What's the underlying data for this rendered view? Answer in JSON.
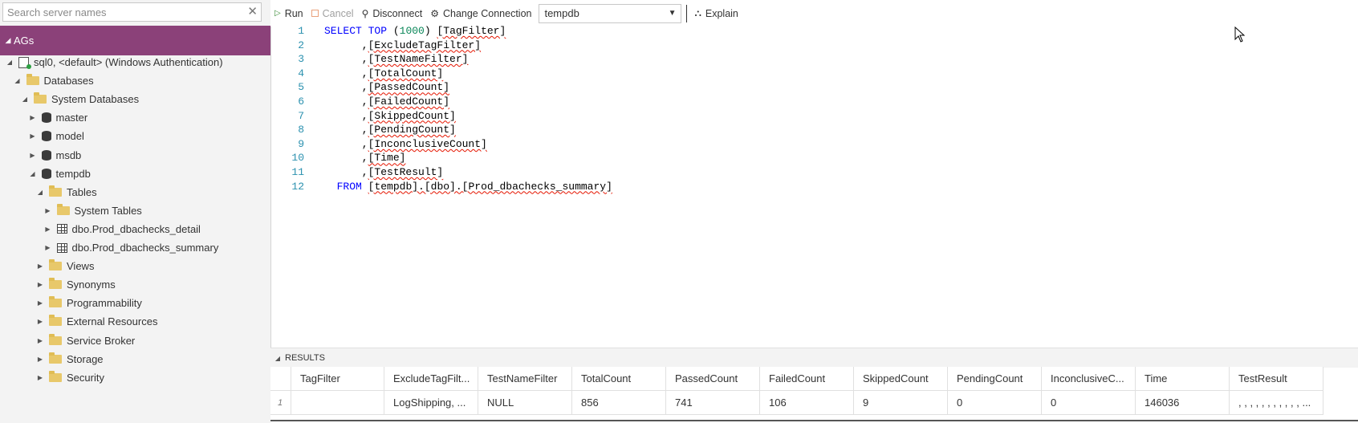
{
  "sidebar": {
    "search_placeholder": "Search server names",
    "group_label": "AGs",
    "tree": [
      {
        "label": "sql0, <default> (Windows Authentication)",
        "icon": "server-icon",
        "level": 1,
        "expanded": true
      },
      {
        "label": "Databases",
        "icon": "folder-icon",
        "level": 2,
        "expanded": true
      },
      {
        "label": "System Databases",
        "icon": "folder-icon",
        "level": 3,
        "expanded": true
      },
      {
        "label": "master",
        "icon": "database-icon",
        "level": 4,
        "expanded": false
      },
      {
        "label": "model",
        "icon": "database-icon",
        "level": 4,
        "expanded": false
      },
      {
        "label": "msdb",
        "icon": "database-icon",
        "level": 4,
        "expanded": false
      },
      {
        "label": "tempdb",
        "icon": "database-icon",
        "level": 4,
        "expanded": true
      },
      {
        "label": "Tables",
        "icon": "folder-icon",
        "level": 5,
        "expanded": true
      },
      {
        "label": "System Tables",
        "icon": "folder-icon",
        "level": 6,
        "expanded": false
      },
      {
        "label": "dbo.Prod_dbachecks_detail",
        "icon": "table-icon",
        "level": 6,
        "expanded": false
      },
      {
        "label": "dbo.Prod_dbachecks_summary",
        "icon": "table-icon",
        "level": 6,
        "expanded": false
      },
      {
        "label": "Views",
        "icon": "folder-icon",
        "level": 5,
        "expanded": false
      },
      {
        "label": "Synonyms",
        "icon": "folder-icon",
        "level": 5,
        "expanded": false
      },
      {
        "label": "Programmability",
        "icon": "folder-icon",
        "level": 5,
        "expanded": false
      },
      {
        "label": "External Resources",
        "icon": "folder-icon",
        "level": 5,
        "expanded": false
      },
      {
        "label": "Service Broker",
        "icon": "folder-icon",
        "level": 5,
        "expanded": false
      },
      {
        "label": "Storage",
        "icon": "folder-icon",
        "level": 5,
        "expanded": false
      },
      {
        "label": "Security",
        "icon": "folder-icon",
        "level": 5,
        "expanded": false
      }
    ]
  },
  "toolbar": {
    "run_label": "Run",
    "cancel_label": "Cancel",
    "disconnect_label": "Disconnect",
    "change_connection_label": "Change Connection",
    "database": "tempdb",
    "explain_label": "Explain"
  },
  "editor": {
    "lines": [
      {
        "num": "1",
        "tokens": [
          {
            "t": "SELECT",
            "c": "kw"
          },
          {
            "t": " "
          },
          {
            "t": "TOP",
            "c": "kw"
          },
          {
            "t": " ("
          },
          {
            "t": "1000",
            "c": "num"
          },
          {
            "t": ") "
          },
          {
            "t": "[TagFilter]",
            "c": "sq"
          }
        ]
      },
      {
        "num": "2",
        "tokens": [
          {
            "t": "      ,"
          },
          {
            "t": "[ExcludeTagFilter]",
            "c": "sq"
          }
        ]
      },
      {
        "num": "3",
        "tokens": [
          {
            "t": "      ,"
          },
          {
            "t": "[TestNameFilter]",
            "c": "sq"
          }
        ]
      },
      {
        "num": "4",
        "tokens": [
          {
            "t": "      ,"
          },
          {
            "t": "[TotalCount]",
            "c": "sq"
          }
        ]
      },
      {
        "num": "5",
        "tokens": [
          {
            "t": "      ,"
          },
          {
            "t": "[PassedCount]",
            "c": "sq"
          }
        ]
      },
      {
        "num": "6",
        "tokens": [
          {
            "t": "      ,"
          },
          {
            "t": "[FailedCount]",
            "c": "sq"
          }
        ]
      },
      {
        "num": "7",
        "tokens": [
          {
            "t": "      ,"
          },
          {
            "t": "[SkippedCount]",
            "c": "sq"
          }
        ]
      },
      {
        "num": "8",
        "tokens": [
          {
            "t": "      ,"
          },
          {
            "t": "[PendingCount]",
            "c": "sq"
          }
        ]
      },
      {
        "num": "9",
        "tokens": [
          {
            "t": "      ,"
          },
          {
            "t": "[InconclusiveCount]",
            "c": "sq"
          }
        ]
      },
      {
        "num": "10",
        "tokens": [
          {
            "t": "      ,"
          },
          {
            "t": "[Time]",
            "c": "sq"
          }
        ]
      },
      {
        "num": "11",
        "tokens": [
          {
            "t": "      ,"
          },
          {
            "t": "[TestResult]",
            "c": "sq"
          }
        ]
      },
      {
        "num": "12",
        "tokens": [
          {
            "t": "  "
          },
          {
            "t": "FROM",
            "c": "kw"
          },
          {
            "t": " "
          },
          {
            "t": "[tempdb].[dbo].[Prod_dbachecks_summary]",
            "c": "sq"
          }
        ]
      }
    ]
  },
  "results": {
    "title": "RESULTS",
    "columns": [
      "TagFilter",
      "ExcludeTagFilt...",
      "TestNameFilter",
      "TotalCount",
      "PassedCount",
      "FailedCount",
      "SkippedCount",
      "PendingCount",
      "InconclusiveC...",
      "Time",
      "TestResult"
    ],
    "rows": [
      {
        "num": "1",
        "cells": [
          "",
          "LogShipping, ...",
          "NULL",
          "856",
          "741",
          "106",
          "9",
          "0",
          "0",
          "146036",
          ", , , , , , , , , , , ..."
        ]
      }
    ]
  }
}
